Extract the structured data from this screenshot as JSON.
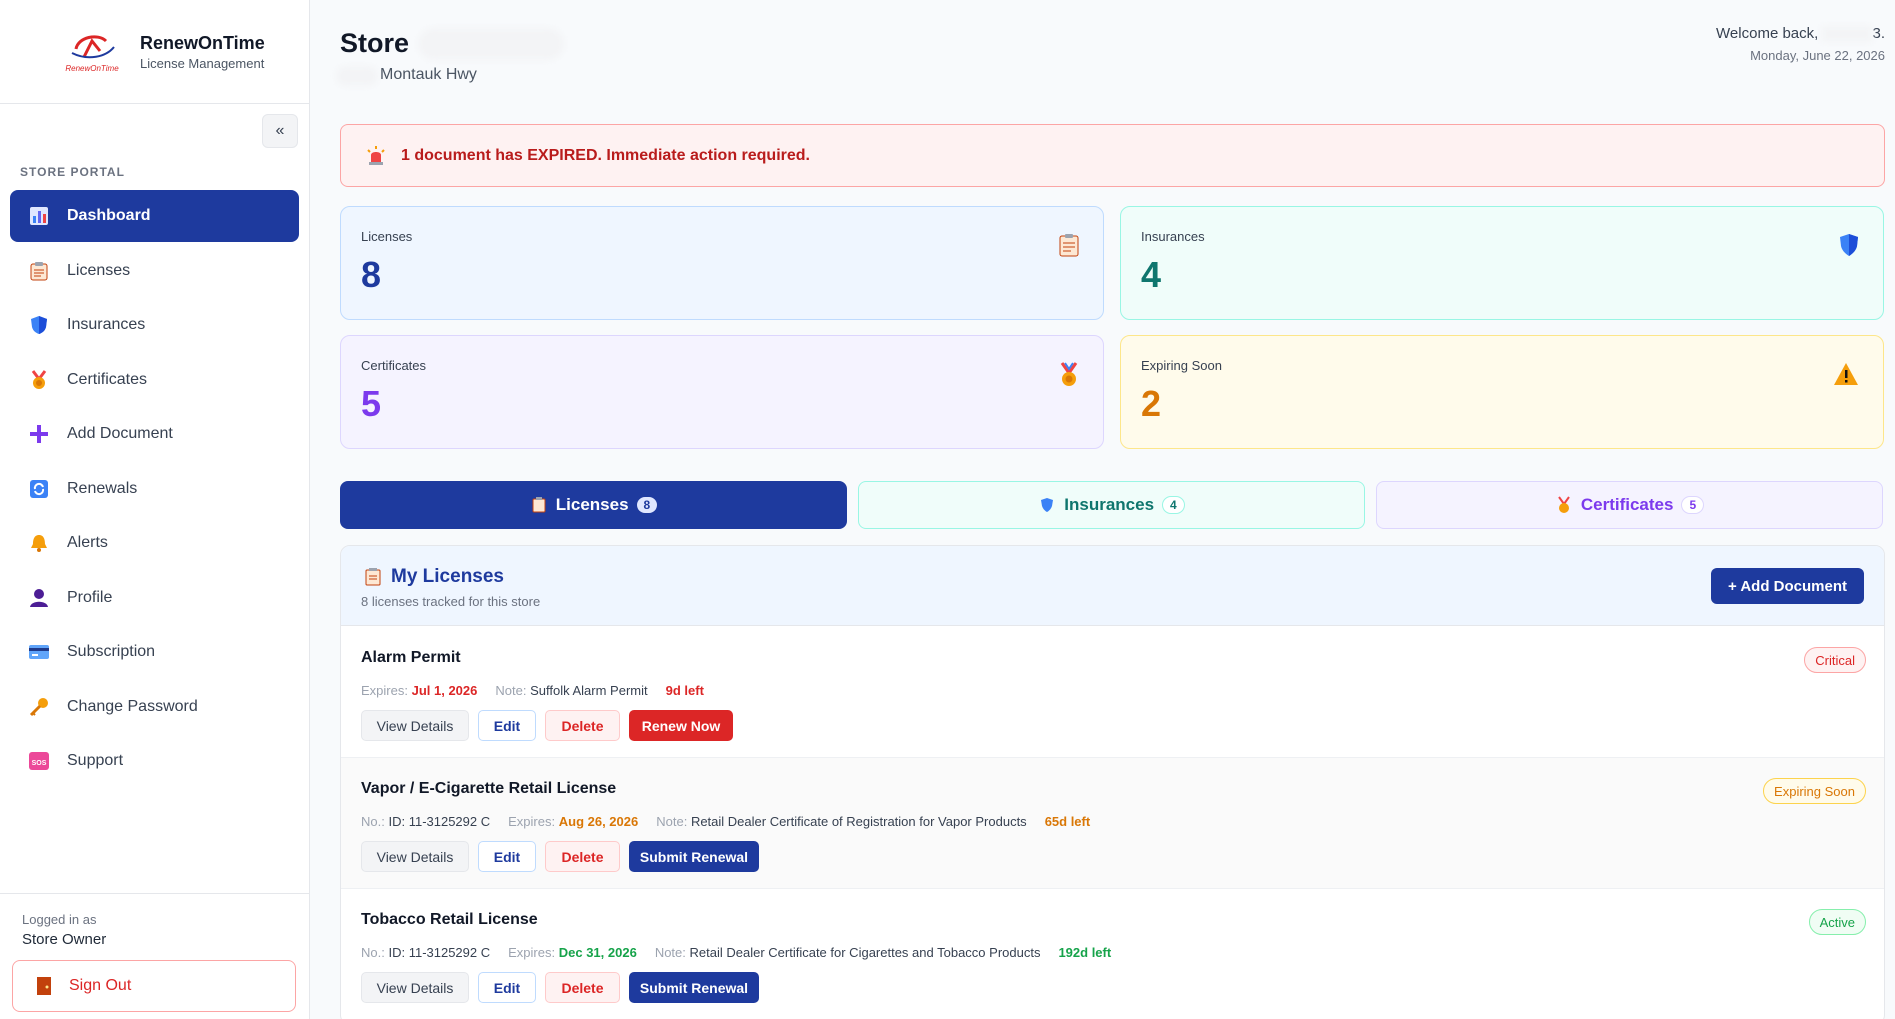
{
  "brand": {
    "name": "RenewOnTime",
    "subtitle": "License Management",
    "logo_text": "RenewOnTime"
  },
  "sidebar": {
    "collapse_label": "«",
    "section_label": "STORE PORTAL",
    "items": [
      {
        "label": "Dashboard",
        "icon": "bar-chart-icon"
      },
      {
        "label": "Licenses",
        "icon": "clipboard-icon"
      },
      {
        "label": "Insurances",
        "icon": "shield-icon"
      },
      {
        "label": "Certificates",
        "icon": "medal-icon"
      },
      {
        "label": "Add Document",
        "icon": "plus-icon"
      },
      {
        "label": "Renewals",
        "icon": "refresh-icon"
      },
      {
        "label": "Alerts",
        "icon": "bell-icon"
      },
      {
        "label": "Profile",
        "icon": "user-icon"
      },
      {
        "label": "Subscription",
        "icon": "credit-card-icon"
      },
      {
        "label": "Change Password",
        "icon": "key-icon"
      },
      {
        "label": "Support",
        "icon": "sos-icon"
      }
    ],
    "logged_in_label": "Logged in as",
    "logged_in_role": "Store Owner",
    "sign_out": "Sign Out"
  },
  "header": {
    "store_title": "Store",
    "store_address": "Montauk Hwy",
    "welcome": "Welcome back,",
    "welcome_suffix": "3.",
    "date": "Monday, June 22, 2026"
  },
  "alert": {
    "text": "1 document has EXPIRED. Immediate action required.",
    "icon": "siren-icon"
  },
  "stats": {
    "licenses": {
      "label": "Licenses",
      "value": "8"
    },
    "insurances": {
      "label": "Insurances",
      "value": "4"
    },
    "certificates": {
      "label": "Certificates",
      "value": "5"
    },
    "expiring": {
      "label": "Expiring Soon",
      "value": "2"
    }
  },
  "tabs": [
    {
      "label": "Licenses",
      "count": "8"
    },
    {
      "label": "Insurances",
      "count": "4"
    },
    {
      "label": "Certificates",
      "count": "5"
    }
  ],
  "panel": {
    "title": "My Licenses",
    "subtitle": "8 licenses tracked for this store",
    "add_button": "+ Add Document"
  },
  "labels": {
    "no": "No.:",
    "expires": "Expires:",
    "note": "Note:",
    "view": "View Details",
    "edit": "Edit",
    "delete": "Delete"
  },
  "documents": [
    {
      "name": "Alarm Permit",
      "number": "",
      "expires": "Jul 1, 2026",
      "note": "Suffolk Alarm Permit",
      "left": "9d left",
      "status": "Critical",
      "action": "Renew Now"
    },
    {
      "name": "Vapor / E-Cigarette Retail License",
      "number": "ID: 11-3125292 C",
      "expires": "Aug 26, 2026",
      "note": "Retail Dealer Certificate of Registration for Vapor Products",
      "left": "65d left",
      "status": "Expiring Soon",
      "action": "Submit Renewal"
    },
    {
      "name": "Tobacco Retail License",
      "number": "ID: 11-3125292 C",
      "expires": "Dec 31, 2026",
      "note": "Retail Dealer Certificate for Cigarettes and Tobacco Products",
      "left": "192d left",
      "status": "Active",
      "action": "Submit Renewal"
    }
  ],
  "colors": {
    "primary": "#1e3a9e",
    "danger": "#dc2626",
    "warning": "#d97706",
    "success": "#16a34a",
    "teal": "#0f766e",
    "purple": "#7c3aed"
  }
}
